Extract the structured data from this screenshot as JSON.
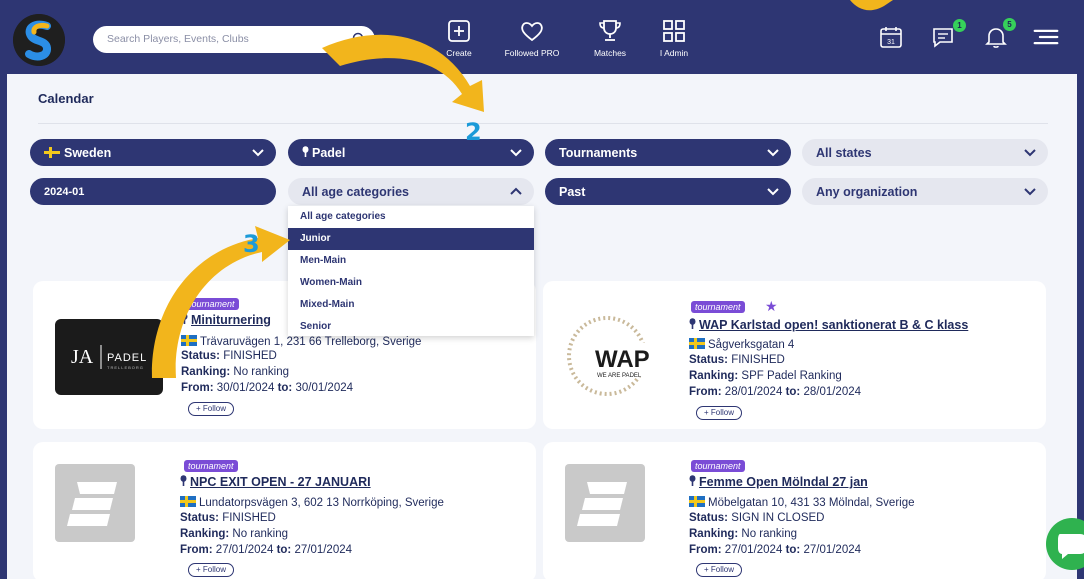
{
  "header": {
    "search_placeholder": "Search Players, Events, Clubs",
    "nav": [
      {
        "label": "Create"
      },
      {
        "label": "Followed PRO"
      },
      {
        "label": "Matches"
      },
      {
        "label": "I Admin"
      }
    ],
    "messages_count": "1",
    "notifications_count": "5",
    "calendar_day": "31"
  },
  "page": {
    "title": "Calendar"
  },
  "filters": {
    "country": "Sweden",
    "sport": "Padel",
    "type": "Tournaments",
    "state": "All states",
    "month": "2024-01",
    "age": "All age categories",
    "period": "Past",
    "organization": "Any organization"
  },
  "age_dropdown": {
    "options": [
      "All age categories",
      "Junior",
      "Men-Main",
      "Women-Main",
      "Mixed-Main",
      "Senior"
    ],
    "selected": "Junior"
  },
  "annotations": {
    "step2": "2",
    "step3": "3"
  },
  "cards": [
    {
      "tag": "tournament",
      "title": "Miniturnering",
      "address": "Trävaruvägen 1, 231 66 Trelleborg, Sverige",
      "status_label": "Status:",
      "status": "FINISHED",
      "ranking_label": "Ranking:",
      "ranking": "No ranking",
      "from_label": "From:",
      "from": "30/01/2024",
      "to_label": "to:",
      "to": "30/01/2024",
      "follow": "+ Follow",
      "logo_text": "PADEL",
      "logo_mark": "JA",
      "logo_sub": "TRELLEBORG"
    },
    {
      "tag": "tournament",
      "title": "WAP Karlstad open! sanktionerat B & C klass",
      "address": "Sågverksgatan 4",
      "status_label": "Status:",
      "status": "FINISHED",
      "ranking_label": "Ranking:",
      "ranking": "SPF Padel Ranking",
      "from_label": "From:",
      "from": "28/01/2024",
      "to_label": "to:",
      "to": "28/01/2024",
      "follow": "+ Follow",
      "logo_text": "WAP",
      "logo_sub": "WE ARE PADEL"
    },
    {
      "tag": "tournament",
      "title": "NPC EXIT OPEN - 27 JANUARI",
      "address": "Lundatorpsvägen 3, 602 13 Norrköping, Sverige",
      "status_label": "Status:",
      "status": "FINISHED",
      "ranking_label": "Ranking:",
      "ranking": "No ranking",
      "from_label": "From:",
      "from": "27/01/2024",
      "to_label": "to:",
      "to": "27/01/2024",
      "follow": "+ Follow"
    },
    {
      "tag": "tournament",
      "title": "Femme Open Mölndal 27 jan",
      "address": "Möbelgatan 10, 431 33 Mölndal, Sverige",
      "status_label": "Status:",
      "status": "SIGN IN CLOSED",
      "ranking_label": "Ranking:",
      "ranking": "No ranking",
      "from_label": "From:",
      "from": "27/01/2024",
      "to_label": "to:",
      "to": "27/01/2024",
      "follow": "+ Follow"
    }
  ],
  "colors": {
    "navy": "#2e3673",
    "accent": "#f2b51c",
    "tag": "#7a4cd6",
    "badge": "#36d15a",
    "chat": "#2fb24f"
  }
}
